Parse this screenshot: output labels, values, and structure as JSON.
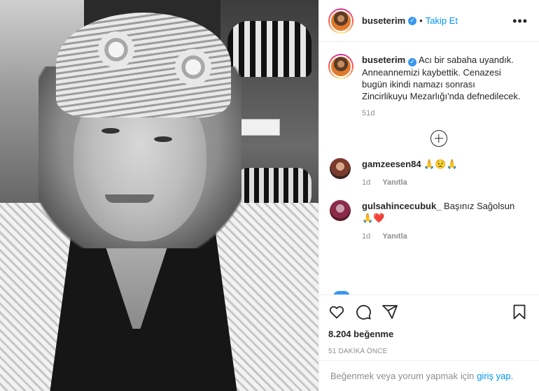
{
  "header": {
    "username": "buseterim",
    "verified_glyph": "✓",
    "separator": "•",
    "follow_label": "Takip Et",
    "more_glyph": "•••"
  },
  "caption": {
    "username": "buseterim",
    "text": "Acı bir sabaha uyandık. Anneannemizi kaybettik. Cenazesi bugün ikindi namazı sonrası Zincirlikuyu Mezarlığı'nda defnedilecek.",
    "age": "51d"
  },
  "comments": [
    {
      "username": "gamzeesen84",
      "text": "🙏😟🙏",
      "age": "1d",
      "reply_label": "Yanıtla"
    },
    {
      "username": "gulsahincecubuk_",
      "text": "Başınız Sağolsun 🙏❤️",
      "age": "1d",
      "reply_label": "Yanıtla"
    }
  ],
  "icons": {
    "like": "heart-icon",
    "comment": "comment-icon",
    "share": "share-icon",
    "save": "bookmark-icon",
    "load_more": "plus-circle-icon"
  },
  "likes_text": "8.204 beğenme",
  "timestamp": "51 DAKİKA ÖNCE",
  "login": {
    "prompt": "Beğenmek veya yorum yapmak için",
    "link": "giriş yap."
  },
  "colors": {
    "link_blue": "#0095f6",
    "verified_blue": "#3897f0",
    "meta_gray": "#8e8e8e"
  }
}
